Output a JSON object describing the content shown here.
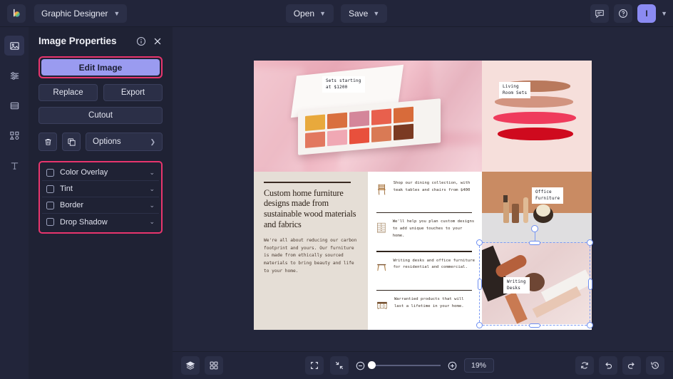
{
  "topbar": {
    "logo_icon": "color-wheel-logo",
    "document_name": "Graphic Designer",
    "open_label": "Open",
    "save_label": "Save",
    "comment_icon": "comment-icon",
    "help_icon": "help-circle-icon",
    "avatar_initial": "I"
  },
  "rail": {
    "items": [
      {
        "name": "image-tool",
        "icon": "image-icon",
        "active": true
      },
      {
        "name": "adjustments-tool",
        "icon": "sliders-icon",
        "active": false
      },
      {
        "name": "layout-tool",
        "icon": "layout-icon",
        "active": false
      },
      {
        "name": "shapes-tool",
        "icon": "shapes-icon",
        "active": false
      },
      {
        "name": "text-tool",
        "icon": "text-t-icon",
        "active": false
      }
    ]
  },
  "panel": {
    "title": "Image Properties",
    "info_icon": "info-circle-icon",
    "close_icon": "close-x-icon",
    "edit_image_label": "Edit Image",
    "replace_label": "Replace",
    "export_label": "Export",
    "cutout_label": "Cutout",
    "delete_icon": "trash-icon",
    "duplicate_icon": "duplicate-icon",
    "options_label": "Options",
    "options_chevron": "chevron-right-icon",
    "effects": [
      {
        "label": "Color Overlay",
        "checked": false
      },
      {
        "label": "Tint",
        "checked": false
      },
      {
        "label": "Border",
        "checked": false
      },
      {
        "label": "Drop Shadow",
        "checked": false
      }
    ]
  },
  "canvas": {
    "hero": {
      "tag": "Sets starting\nat $1200",
      "pans_row1": [
        "#e8a93c",
        "#d9703f",
        "#d4869a",
        "#e8604d",
        "#d86b3a"
      ],
      "pans_row2": [
        "#e2785f",
        "#f0a8b4",
        "#e8503c",
        "#d97a55",
        "#7b3a22"
      ]
    },
    "swatches": {
      "tag": "Living\nRoom Sets",
      "background": "#f6dfdb",
      "colors": [
        "#b9795c",
        "#d29480",
        "#ef3b5c",
        "#cf0a1e"
      ]
    },
    "text_block": {
      "headline": "Custom home furniture designs made from sustainable wood materials and fabrics",
      "body": "We're all about reducing our carbon footprint and yours. Our furniture is made from ethically sourced materials to bring beauty and life to your home."
    },
    "features": [
      {
        "icon": "chair-icon",
        "text": "Shop our dining collection, with teak tables and chairs from $400"
      },
      {
        "icon": "dresser-icon",
        "text": "We'll help you plan custom designs to add unique touches to your home."
      },
      {
        "icon": "desk-icon",
        "text": "Writing desks and office furniture for residential and commercial."
      },
      {
        "icon": "sideboard-icon",
        "text": "Warrantied products that will last a lifetime in your home."
      }
    ],
    "office_image": {
      "tag": "Office\nFurniture"
    },
    "desk_image": {
      "tag": "Writing\nDesks",
      "selected": true
    }
  },
  "bottombar": {
    "layers_icon": "layers-icon",
    "grid_icon": "grid-icon",
    "fit_screen_icon": "fit-screen-icon",
    "fit_selection_icon": "fit-selection-icon",
    "zoom_out_icon": "zoom-out-icon",
    "zoom_in_icon": "zoom-in-icon",
    "zoom_level": "19%",
    "refresh_icon": "refresh-icon",
    "undo_icon": "undo-icon",
    "redo_icon": "redo-icon",
    "history_icon": "history-icon"
  },
  "colors": {
    "accent_purple": "#9a9bf0",
    "highlight_pink": "#e8356d",
    "selection_blue": "#6d8ef2",
    "panel_bg": "#1f2234",
    "chrome_bg": "#22253a"
  }
}
